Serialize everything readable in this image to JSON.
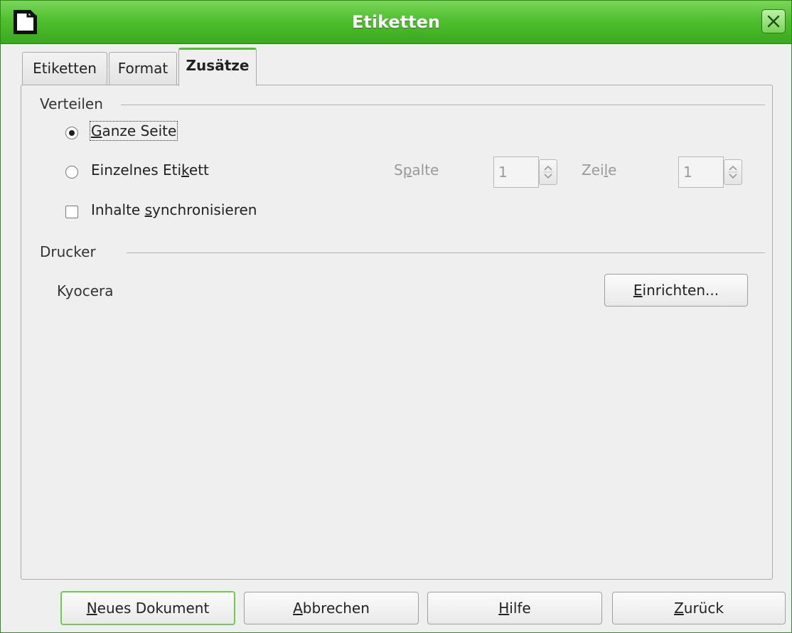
{
  "window": {
    "title": "Etiketten"
  },
  "tabs": [
    {
      "label": "Etiketten",
      "active": false
    },
    {
      "label": "Format",
      "active": false
    },
    {
      "label": "Zusätze",
      "active": true
    }
  ],
  "verteilen": {
    "heading": "Verteilen",
    "options": {
      "ganze_seite": {
        "pre": "",
        "acc": "G",
        "post": "anze Seite",
        "selected": true
      },
      "einzelnes": {
        "pre": "Einzelnes Eti",
        "acc": "k",
        "post": "ett",
        "selected": false
      }
    },
    "spalte": {
      "pre": "S",
      "acc": "p",
      "post": "alte",
      "value": "1"
    },
    "zeile": {
      "pre": "Zei",
      "acc": "l",
      "post": "e",
      "value": "1"
    },
    "sync": {
      "pre": "Inhalte ",
      "acc": "s",
      "post": "ynchronisieren",
      "checked": false
    }
  },
  "drucker": {
    "heading": "Drucker",
    "printer_name": "Kyocera",
    "setup_button": {
      "pre": "",
      "acc": "E",
      "post": "inrichten..."
    }
  },
  "footer": {
    "neues": {
      "pre": "",
      "acc": "N",
      "post": "eues Dokument"
    },
    "abbrechen": {
      "pre": "",
      "acc": "A",
      "post": "bbrechen"
    },
    "hilfe": {
      "pre": "",
      "acc": "H",
      "post": "ilfe"
    },
    "zurueck": {
      "pre": "",
      "acc": "Z",
      "post": "urück"
    }
  },
  "colors": {
    "titlebar": "#4fbf2f",
    "title_text": "#ffffff",
    "default_button_border": "#6ccf4a",
    "disabled_text": "#9a9a9a"
  },
  "icons": {
    "app": "document-icon",
    "close": "close-icon",
    "spin": "spin-up-down-icon"
  }
}
